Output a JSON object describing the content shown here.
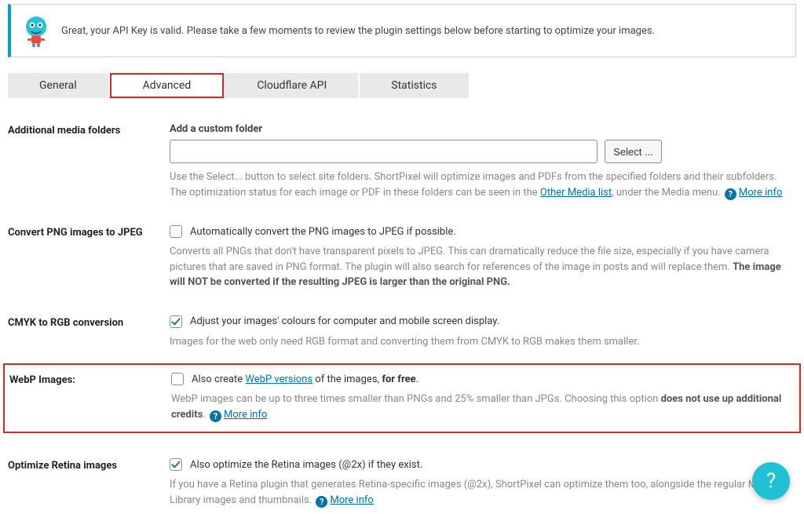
{
  "notice": {
    "message": "Great, your API Key is valid. Please take a few moments to review the plugin settings below before starting to optimize your images."
  },
  "tabs": {
    "items": [
      {
        "label": "General"
      },
      {
        "label": "Advanced"
      },
      {
        "label": "Cloudflare API"
      },
      {
        "label": "Statistics"
      }
    ],
    "active_index": 1
  },
  "sections": {
    "media_folders": {
      "label": "Additional media folders",
      "field_title": "Add a custom folder",
      "input_value": "",
      "select_btn": "Select ...",
      "desc_1": "Use the Select... button to select site folders. ShortPixel will optimize images and PDFs from the specified folders and their subfolders. The optimization status for each image or PDF in these folders can be seen in the ",
      "link_other_media": "Other Media list",
      "desc_2": ", under the Media menu. ",
      "more_info": "More info"
    },
    "png_jpeg": {
      "label": "Convert PNG images to JPEG",
      "checkbox_label": "Automatically convert the PNG images to JPEG if possible.",
      "checked": false,
      "desc_1": "Converts all PNGs that don't have transparent pixels to JPEG. This can dramatically reduce the file size, especially if you have camera pictures that are saved in PNG format. The plugin will also search for references of the image in posts and will replace them. ",
      "desc_bold": "The image will NOT be converted if the resulting JPEG is larger than the original PNG."
    },
    "cmyk": {
      "label": "CMYK to RGB conversion",
      "checkbox_label": "Adjust your images' colours for computer and mobile screen display.",
      "checked": true,
      "desc": "Images for the web only need RGB format and converting them from CMYK to RGB makes them smaller."
    },
    "webp": {
      "label": "WebP Images:",
      "checked": false,
      "cb_prefix": "Also create ",
      "cb_link": "WebP versions",
      "cb_mid": " of the images, ",
      "cb_bold": "for free",
      "cb_suffix": ".",
      "desc_1": "WebP images can be up to three times smaller than PNGs and 25% smaller than JPGs. Choosing this option ",
      "desc_bold": "does not use up additional credits",
      "desc_2": ". ",
      "more_info": "More info"
    },
    "retina": {
      "label": "Optimize Retina images",
      "checkbox_label": "Also optimize the Retina images (@2x) if they exist.",
      "checked": true,
      "desc": "If you have a Retina plugin that generates Retina-specific images (@2x), ShortPixel can optimize them too, alongside the regular Media Library images and thumbnails. ",
      "more_info": "More info"
    }
  }
}
